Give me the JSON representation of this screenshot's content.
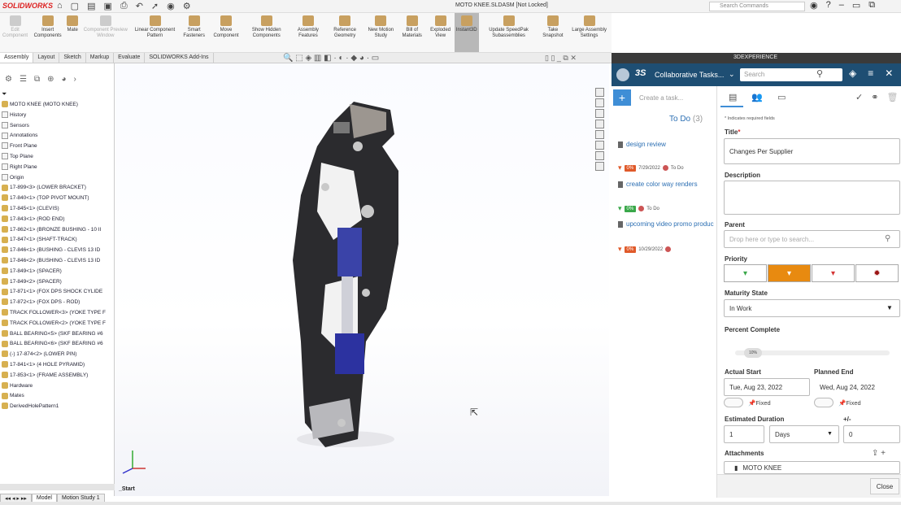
{
  "app": {
    "logo": "SOLIDWORKS",
    "doc_title": "MOTO KNEE.SLDASM [Not Locked]",
    "search_commands": "Search Commands"
  },
  "ribbon": [
    {
      "label": "Edit Component",
      "disabled": true
    },
    {
      "label": "Insert Components"
    },
    {
      "label": "Mate"
    },
    {
      "label": "Component Preview Window",
      "disabled": true
    },
    {
      "label": "Linear Component Pattern"
    },
    {
      "label": "Smart Fasteners"
    },
    {
      "label": "Move Component"
    },
    {
      "label": "Show Hidden Components"
    },
    {
      "label": "Assembly Features"
    },
    {
      "label": "Reference Geometry"
    },
    {
      "label": "New Motion Study"
    },
    {
      "label": "Bill of Materials"
    },
    {
      "label": "Exploded View"
    },
    {
      "label": "Instant3D",
      "active": true
    },
    {
      "label": "Update SpeedPak Subassemblies"
    },
    {
      "label": "Take Snapshot"
    },
    {
      "label": "Large Assembly Settings"
    }
  ],
  "cm_tabs": [
    "Assembly",
    "Layout",
    "Sketch",
    "Markup",
    "Evaluate",
    "SOLIDWORKS Add-Ins"
  ],
  "tree": {
    "root": "MOTO KNEE (MOTO KNEE)",
    "folders": [
      "History",
      "Sensors",
      "Annotations"
    ],
    "planes": [
      "Front Plane",
      "Top Plane",
      "Right Plane",
      "Origin"
    ],
    "items": [
      "17-899<3> (LOWER BRACKET)",
      "17-840<1> (TOP PIVOT MOUNT)",
      "17-845<1> (CLEVIS)",
      "17-843<1> (ROD END)",
      "17-862<1> (BRONZE BUSHING - 10 II",
      "17-847<1> (SHAFT-TRACK)",
      "17-846<1> (BUSHING - CLEVIS 13 ID",
      "17-846<2> (BUSHING - CLEVIS 13 ID",
      "17-849<1> (SPACER)",
      "17-849<2> (SPACER)",
      "17-871<1> (FOX DPS SHOCK CYLIDE",
      "17-872<1> (FOX DPS - ROD)",
      "TRACK FOLLOWER<3> (YOKE TYPE F",
      "TRACK FOLLOWER<2> (YOKE TYPE F",
      "BALL BEARING<5> (SKF BEARING #6",
      "BALL BEARING<6> (SKF BEARING #6",
      "(-) 17-874<2> (LOWER PIN)",
      "17-841<1> (4 HOLE PYRAMID)",
      "17-853<1> (FRAME ASSEMBLY)",
      "Hardware",
      "Mates",
      "DerivedHolePattern1"
    ]
  },
  "bottom_tabs": [
    "Model",
    "Motion Study 1"
  ],
  "viewport": {
    "start_label": "_Start"
  },
  "panel": {
    "header": "3DEXPERIENCE",
    "app_title": "Collaborative Tasks...",
    "search_placeholder": "Search",
    "create_placeholder": "Create a task...",
    "todo_label": "To Do",
    "todo_count": "(3)",
    "tasks": [
      {
        "title": "design review",
        "percent": "0%",
        "date": "7/29/2022",
        "status": "To Do",
        "color": "#e05a2a"
      },
      {
        "title": "create color way renders",
        "percent": "0%",
        "date": "",
        "status": "To Do",
        "color": "#3aa84a"
      },
      {
        "title": "upcoming video promo produc",
        "percent": "0%",
        "date": "10/29/2022",
        "status": "",
        "color": "#e05a2a"
      }
    ]
  },
  "form": {
    "required_note": "* Indicates required fields",
    "title_label": "Title",
    "title_value": "Changes Per Supplier",
    "description_label": "Description",
    "parent_label": "Parent",
    "parent_placeholder": "Drop here or type to search...",
    "priority_label": "Priority",
    "priority_colors": [
      "#3aa84a",
      "#e88a10",
      "#d43535",
      "#9b1414"
    ],
    "maturity_label": "Maturity State",
    "maturity_value": "In Work",
    "percent_label": "Percent Complete",
    "percent_value": "10%",
    "actual_start_label": "Actual Start",
    "actual_start_value": "Tue, Aug 23, 2022",
    "planned_end_label": "Planned End",
    "planned_end_value": "Wed, Aug 24, 2022",
    "fixed_label": "Fixed",
    "duration_label": "Estimated Duration",
    "duration_value": "1",
    "duration_unit": "Days",
    "plusminus_label": "+/-",
    "plusminus_value": "0",
    "attachments_label": "Attachments",
    "attachment_name": "MOTO KNEE",
    "close_label": "Close"
  }
}
